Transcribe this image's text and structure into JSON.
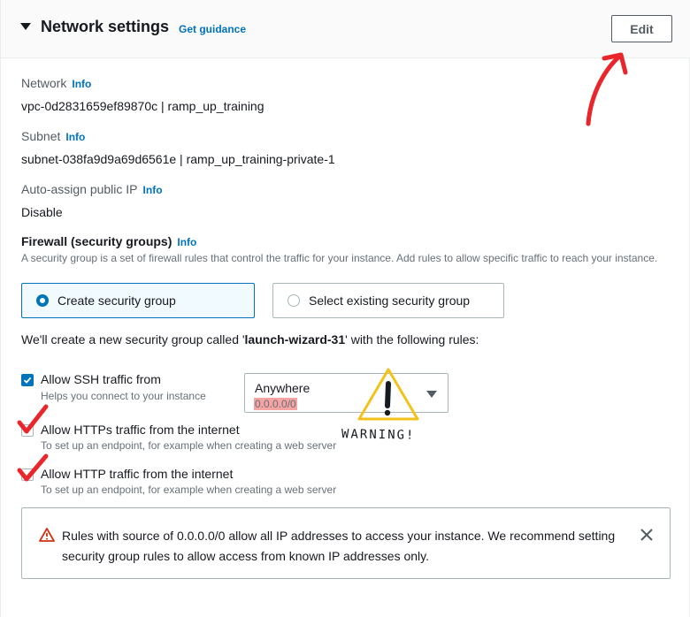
{
  "header": {
    "title": "Network settings",
    "guidance": "Get guidance",
    "edit_label": "Edit"
  },
  "network": {
    "label": "Network",
    "info": "Info",
    "value": "vpc-0d2831659ef89870c | ramp_up_training"
  },
  "subnet": {
    "label": "Subnet",
    "info": "Info",
    "value": "subnet-038fa9d9a69d6561e | ramp_up_training-private-1"
  },
  "public_ip": {
    "label": "Auto-assign public IP",
    "info": "Info",
    "value": "Disable"
  },
  "firewall": {
    "title": "Firewall (security groups)",
    "info": "Info",
    "description": "A security group is a set of firewall rules that control the traffic for your instance. Add rules to allow specific traffic to reach your instance.",
    "options": [
      {
        "label": "Create security group",
        "selected": true
      },
      {
        "label": "Select existing security group",
        "selected": false
      }
    ]
  },
  "sg_line": {
    "prefix": "We'll create a new security group called '",
    "name": "launch-wizard-31",
    "suffix": "' with the following rules:"
  },
  "rules": [
    {
      "label": "Allow SSH traffic from",
      "description": "Helps you connect to your instance",
      "checked": true
    },
    {
      "label": "Allow HTTPs traffic from the internet",
      "description": "To set up an endpoint, for example when creating a web server",
      "checked": false
    },
    {
      "label": "Allow HTTP traffic from the internet",
      "description": "To set up an endpoint, for example when creating a web server",
      "checked": false
    }
  ],
  "ssh_source": {
    "value": "Anywhere",
    "cidr": "0.0.0.0/0"
  },
  "alert": {
    "text": "Rules with source of 0.0.0.0/0 allow all IP addresses to access your instance. We recommend setting security group rules to allow access from known IP addresses only."
  },
  "annotation": {
    "warning": "WARNING!"
  },
  "colors": {
    "accent": "#0073bb",
    "annotation_red": "#e8262b",
    "warning_yellow": "#f2c21b",
    "highlight": "#f5a3a3"
  },
  "icons": [
    "caret-down-icon",
    "checkbox-check-icon",
    "warning-icon",
    "close-icon",
    "dropdown-caret-icon"
  ]
}
